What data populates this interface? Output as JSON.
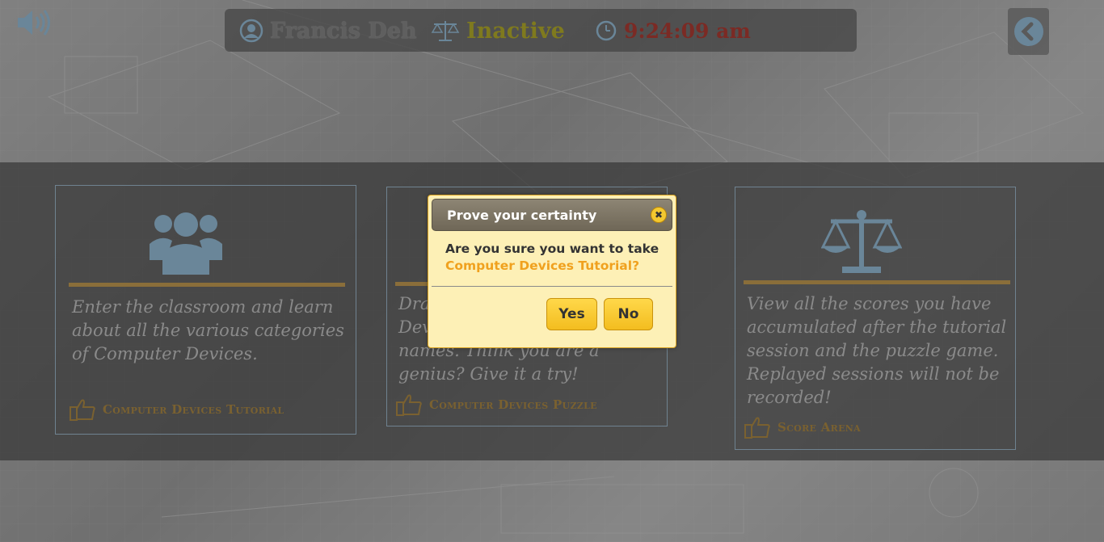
{
  "user": {
    "name": "Francis Deh",
    "status": "Inactive",
    "time": "9:24:09 am"
  },
  "cards": [
    {
      "description": "Enter the classroom and learn about all the various categories of Computer Devices.",
      "link": "Computer Devices Tutorial",
      "icon": "users-icon"
    },
    {
      "description": "Dra... Dev... names. Think you are a genius? Give it a try!",
      "description_lines": [
        "Dra",
        "Dev",
        "names. Think you are a",
        "genius? Give it a try!"
      ],
      "link": "Computer Devices Puzzle",
      "icon": "puzzle-icon"
    },
    {
      "description": "View all the scores you have accumulated after the tutorial session and the puzzle game. Replayed sessions will not be recorded!",
      "link": "Score Arena",
      "icon": "scales-icon"
    }
  ],
  "dialog": {
    "title": "Prove your certainty",
    "question": "Are you sure you want to take",
    "target": "Computer Devices Tutorial?",
    "yes_label": "Yes",
    "no_label": "No",
    "close_symbol": "✖"
  },
  "colors": {
    "accent": "#f3bd1f",
    "dialog_bg": "#fdf0b6",
    "link": "#7a6130",
    "target_text": "#f0a11e"
  }
}
